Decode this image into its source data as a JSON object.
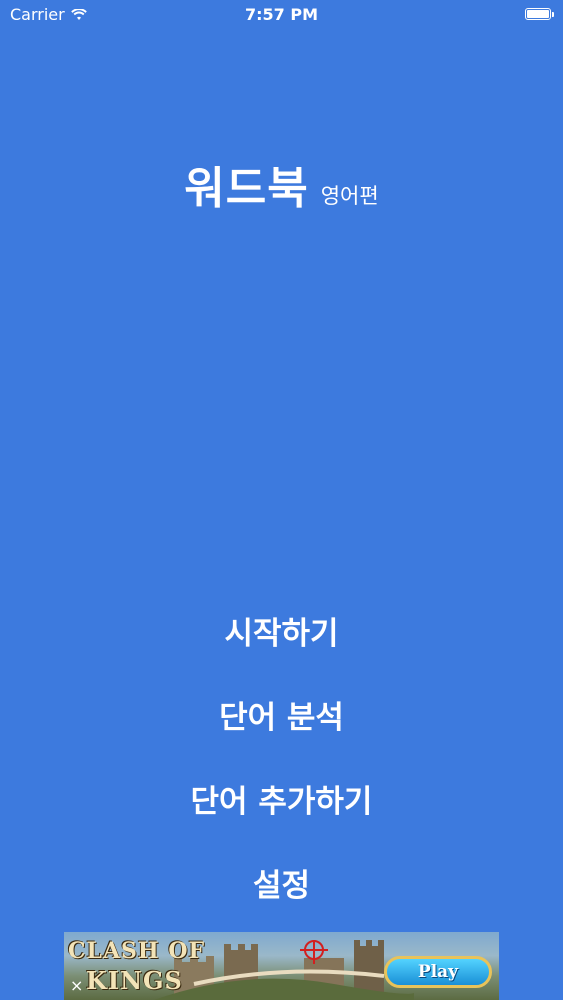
{
  "status_bar": {
    "carrier": "Carrier",
    "time": "7:57 PM"
  },
  "title": {
    "main": "워드북",
    "sub": "영어편"
  },
  "menu": {
    "items": [
      {
        "label": "시작하기"
      },
      {
        "label": "단어 분석"
      },
      {
        "label": "단어 추가하기"
      },
      {
        "label": "설정"
      }
    ]
  },
  "ad": {
    "logo_line1": "CLASH OF",
    "logo_line2": "KINGS",
    "play_label": "Play",
    "close_label": "×"
  },
  "colors": {
    "background": "#3d7ade",
    "text": "#ffffff"
  },
  "icons": {
    "wifi": "wifi-icon",
    "battery": "battery-icon"
  }
}
